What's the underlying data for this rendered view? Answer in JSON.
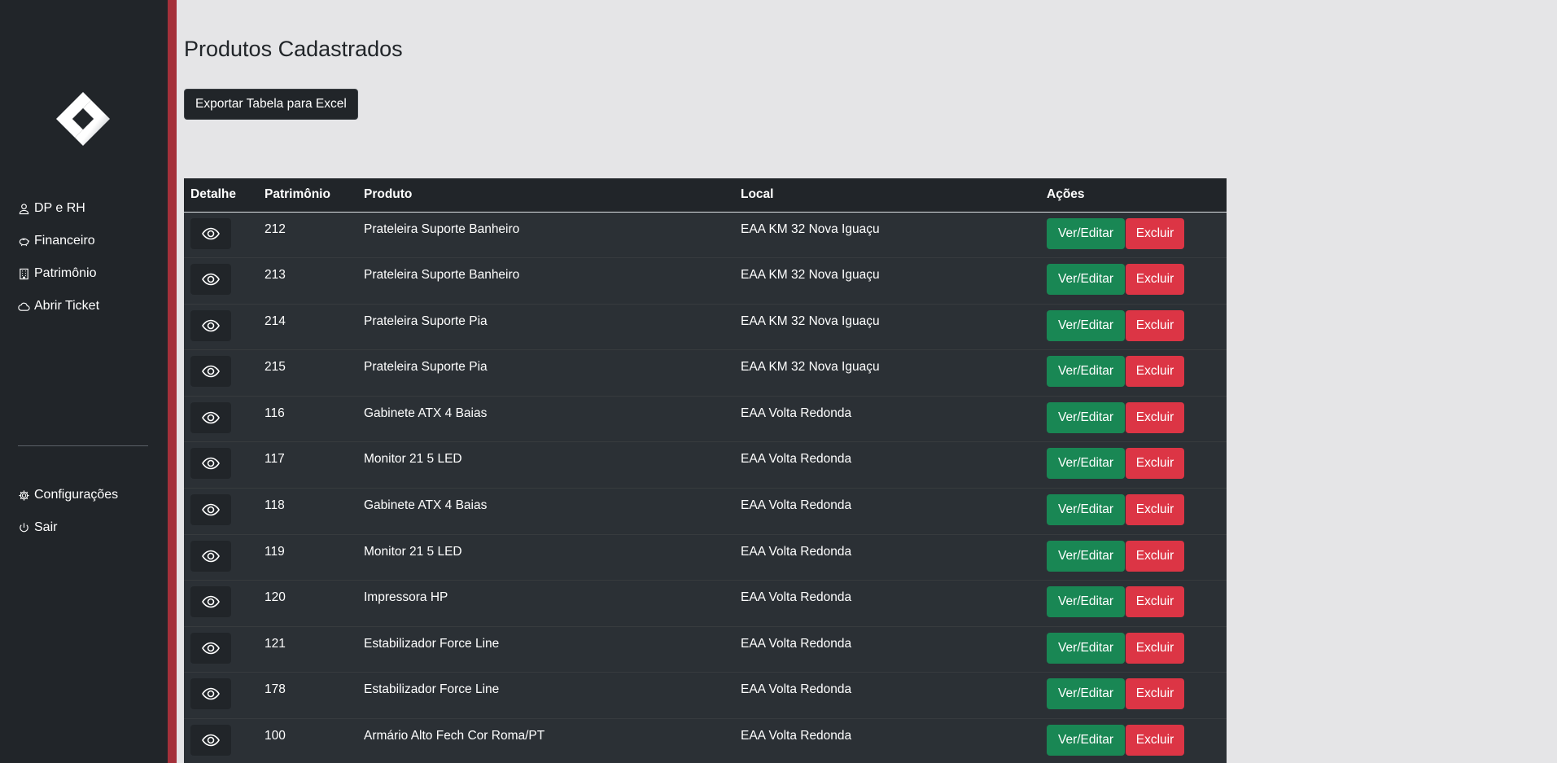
{
  "sidebar": {
    "nav_top": [
      {
        "label": "DP e RH",
        "icon": "person-icon"
      },
      {
        "label": "Financeiro",
        "icon": "piggy-bank-icon"
      },
      {
        "label": "Patrimônio",
        "icon": "building-icon"
      },
      {
        "label": "Abrir Ticket",
        "icon": "cloud-icon"
      }
    ],
    "nav_bottom": [
      {
        "label": "Configurações",
        "icon": "gear-icon"
      },
      {
        "label": "Sair",
        "icon": "power-icon"
      }
    ]
  },
  "main": {
    "title": "Produtos Cadastrados",
    "export_label": "Exportar Tabela para Excel"
  },
  "table": {
    "headers": [
      "Detalhe",
      "Patrimônio",
      "Produto",
      "Local",
      "Ações"
    ],
    "edit_label": "Ver/Editar",
    "delete_label": "Excluir",
    "rows": [
      {
        "pat": "212",
        "produto": "Prateleira Suporte Banheiro",
        "local": "EAA KM 32 Nova Iguaçu"
      },
      {
        "pat": "213",
        "produto": "Prateleira Suporte Banheiro",
        "local": "EAA KM 32 Nova Iguaçu"
      },
      {
        "pat": "214",
        "produto": "Prateleira Suporte Pia",
        "local": "EAA KM 32 Nova Iguaçu"
      },
      {
        "pat": "215",
        "produto": "Prateleira Suporte Pia",
        "local": "EAA KM 32 Nova Iguaçu"
      },
      {
        "pat": "116",
        "produto": "Gabinete ATX 4 Baias",
        "local": "EAA Volta Redonda"
      },
      {
        "pat": "117",
        "produto": "Monitor 21 5 LED",
        "local": "EAA Volta Redonda"
      },
      {
        "pat": "118",
        "produto": "Gabinete ATX 4 Baias",
        "local": "EAA Volta Redonda"
      },
      {
        "pat": "119",
        "produto": "Monitor 21 5 LED",
        "local": "EAA Volta Redonda"
      },
      {
        "pat": "120",
        "produto": "Impressora HP",
        "local": "EAA Volta Redonda"
      },
      {
        "pat": "121",
        "produto": "Estabilizador Force Line",
        "local": "EAA Volta Redonda"
      },
      {
        "pat": "178",
        "produto": "Estabilizador Force Line",
        "local": "EAA Volta Redonda"
      },
      {
        "pat": "100",
        "produto": "Armário Alto Fech Cor Roma/PT",
        "local": "EAA Volta Redonda"
      }
    ]
  },
  "colors": {
    "sidebar_bg": "#212529",
    "stripe": "#a4303a",
    "edit_button": "#198754",
    "delete_button": "#dc3545"
  }
}
